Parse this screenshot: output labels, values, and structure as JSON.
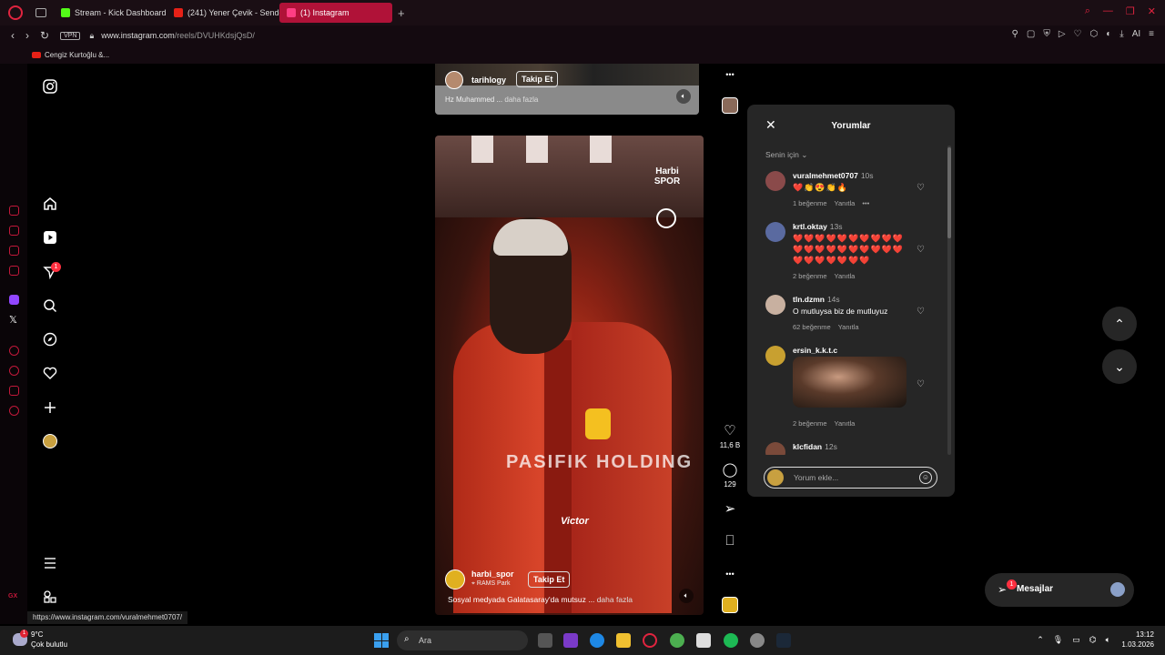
{
  "browser": {
    "tabs": [
      {
        "label": "Stream - Kick Dashboard",
        "icon": "kick-icon",
        "color": "#53fc18"
      },
      {
        "label": "(241) Yener Çevik - Sende",
        "icon": "youtube-icon",
        "color": "#e62117"
      },
      {
        "label": "(1) Instagram",
        "icon": "instagram-icon",
        "color": "#ff3e84"
      }
    ],
    "vpn_label": "VPN",
    "url_host": "www.instagram.com",
    "url_path": "/reels/DVUHKdsjQsD/",
    "bookmark": "Cengiz Kurtoğlu &...",
    "ai_label": "AI",
    "accent": "#e0243f"
  },
  "nav": {
    "notification_count": "1"
  },
  "reel_top": {
    "username": "tarihlogy",
    "follow_label": "Takip Et",
    "caption": "Hz Muhammed ...",
    "more": "daha fazla"
  },
  "reel_main": {
    "watermark": "Harbi SPOR",
    "overlay_text": "Victor",
    "username": "harbi_spor",
    "follow_label": "Takip Et",
    "location": "RAMS Park",
    "caption": "Sosyal medyada Galatasaray'da mutsuz ...",
    "more": "daha fazla",
    "sponsor_text": "PASIFIK HOLDING"
  },
  "actions": {
    "likes": "11,6 B",
    "comments": "129",
    "top_more": "•••",
    "bottom_more": "•••"
  },
  "comments_panel": {
    "title": "Yorumlar",
    "filter": "Senin için",
    "items": [
      {
        "user": "vuralmehmet0707",
        "time": "10s",
        "text": "❤️👏😍👏🔥",
        "likes": "1 beğenme",
        "reply": "Yanıtla",
        "more": "•••",
        "avatar_color": "#8a4a4a"
      },
      {
        "user": "krtl.oktay",
        "time": "13s",
        "text": "❤️❤️❤️❤️❤️❤️❤️❤️❤️❤️ ❤️❤️❤️❤️❤️❤️❤️❤️❤️❤️ ❤️❤️❤️❤️❤️❤️❤️",
        "likes": "2 beğenme",
        "reply": "Yanıtla",
        "avatar_color": "#5a6aa0"
      },
      {
        "user": "tln.dzmn",
        "time": "14s",
        "text": "O mutluysa biz de mutluyuz",
        "likes": "62 beğenme",
        "reply": "Yanıtla",
        "avatar_color": "#c8b0a0"
      },
      {
        "user": "ersin_k.k.t.c",
        "time": "",
        "text": "",
        "likes": "2 beğenme",
        "reply": "Yanıtla",
        "avatar_color": "#c8a030"
      },
      {
        "user": "klcfidan",
        "time": "12s",
        "text": "",
        "likes": "",
        "reply": "",
        "avatar_color": "#7a4a3a"
      }
    ],
    "input_placeholder": "Yorum ekle..."
  },
  "messages": {
    "label": "Mesajlar",
    "count": "1"
  },
  "status_url": "https://www.instagram.com/vuralmehmet0707/",
  "taskbar": {
    "temp": "9°C",
    "weather": "Çok bulutlu",
    "weather_badge": "1",
    "search_placeholder": "Ara",
    "time": "13:12",
    "date": "1.03.2026"
  }
}
